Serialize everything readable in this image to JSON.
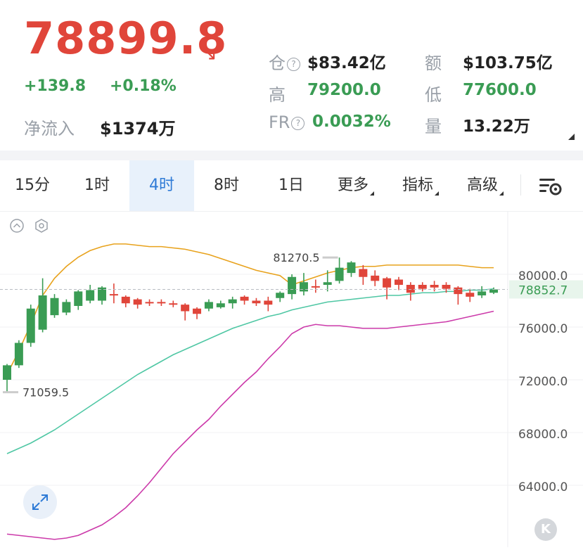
{
  "ticker": {
    "price": "78899.8",
    "change": "+139.8",
    "change_pct": "+0.18%",
    "net_inflow_label": "净流入",
    "net_inflow_value": "$1374万",
    "open_interest_label": "仓",
    "open_interest_value": "$83.42亿",
    "turnover_label": "额",
    "turnover_value": "$103.75亿",
    "high_label": "高",
    "high_value": "79200.0",
    "low_label": "低",
    "low_value": "77600.0",
    "fr_label": "FR",
    "fr_value": "0.0032%",
    "volume_label": "量",
    "volume_value": "13.22万",
    "help_glyph": "?",
    "down_color": "#e0453a",
    "up_color": "#3a9c54"
  },
  "tabs": [
    {
      "label": "15分",
      "active": false
    },
    {
      "label": "1时",
      "active": false
    },
    {
      "label": "4时",
      "active": true
    },
    {
      "label": "8时",
      "active": false
    },
    {
      "label": "1日",
      "active": false
    },
    {
      "label": "更多",
      "active": false
    },
    {
      "label": "指标",
      "active": false
    },
    {
      "label": "高级",
      "active": false
    }
  ],
  "k_button": "K",
  "chart_data": {
    "type": "candlestick",
    "y_ticks": [
      "80000.0",
      "76000.0",
      "72000.0",
      "68000.0",
      "64000.0"
    ],
    "y_tick_values": [
      80000,
      76000,
      72000,
      68000,
      64000
    ],
    "current_price_label": "78852.7",
    "current_price": 78852.7,
    "high_marker": "81270.5",
    "high_marker_value": 81270.5,
    "low_marker": "71059.5",
    "low_marker_value": 71059.5,
    "candles": [
      [
        72000,
        73100,
        71059.5,
        73200
      ],
      [
        73100,
        74800,
        72900,
        75000
      ],
      [
        74800,
        77400,
        74500,
        77700
      ],
      [
        75800,
        78400,
        75600,
        79700
      ],
      [
        76900,
        78200,
        76700,
        78500
      ],
      [
        77100,
        77900,
        76900,
        78100
      ],
      [
        77600,
        78700,
        77300,
        78800
      ],
      [
        78000,
        78800,
        77800,
        79200
      ],
      [
        78000,
        79000,
        77700,
        79100
      ],
      [
        78500,
        78400,
        77800,
        79300
      ],
      [
        78300,
        77800,
        77500,
        78400
      ],
      [
        78100,
        77700,
        77400,
        78200
      ],
      [
        77900,
        77800,
        77600,
        78100
      ],
      [
        77900,
        77800,
        77600,
        78100
      ],
      [
        77800,
        77700,
        77500,
        78000
      ],
      [
        77700,
        77200,
        76500,
        77800
      ],
      [
        77400,
        77000,
        76600,
        77500
      ],
      [
        77400,
        77900,
        77200,
        78100
      ],
      [
        77500,
        77800,
        77400,
        78000
      ],
      [
        77800,
        78100,
        77400,
        78300
      ],
      [
        78300,
        78000,
        77700,
        78400
      ],
      [
        78000,
        77800,
        77600,
        78200
      ],
      [
        78000,
        77700,
        77200,
        78300
      ],
      [
        78200,
        78600,
        77900,
        78700
      ],
      [
        78500,
        79800,
        78100,
        80000
      ],
      [
        78700,
        79400,
        78400,
        80100
      ],
      [
        79100,
        79000,
        78600,
        79600
      ],
      [
        79200,
        79400,
        78700,
        80300
      ],
      [
        79500,
        80500,
        79300,
        81270.5
      ],
      [
        80100,
        80900,
        79800,
        81000
      ],
      [
        80400,
        79800,
        79200,
        80700
      ],
      [
        79900,
        79500,
        79100,
        80300
      ],
      [
        79700,
        79000,
        78100,
        79800
      ],
      [
        79600,
        79200,
        78800,
        79800
      ],
      [
        79200,
        78600,
        78000,
        79400
      ],
      [
        79200,
        78900,
        78700,
        79400
      ],
      [
        79200,
        79000,
        78700,
        79500
      ],
      [
        79200,
        78900,
        78600,
        79400
      ],
      [
        79000,
        78500,
        77700,
        79100
      ],
      [
        78600,
        78300,
        77900,
        78900
      ],
      [
        78400,
        78700,
        78200,
        79100
      ],
      [
        78600,
        78852.7,
        78500,
        79000
      ]
    ],
    "series": [
      {
        "color": "#e8a21c",
        "values": [
          72400,
          74200,
          76200,
          78400,
          79700,
          80600,
          81300,
          81800,
          82100,
          82300,
          82300,
          82200,
          82100,
          82100,
          82000,
          81900,
          81700,
          81500,
          81200,
          80900,
          80600,
          80300,
          80100,
          79900,
          79200,
          79500,
          79800,
          80100,
          80300,
          80500,
          80600,
          80600,
          80700,
          80700,
          80700,
          80700,
          80700,
          80700,
          80700,
          80600,
          80500,
          80500
        ]
      },
      {
        "color": "#4fc7a4",
        "values": [
          66400,
          66800,
          67200,
          67700,
          68200,
          68800,
          69400,
          70000,
          70600,
          71200,
          71800,
          72400,
          72900,
          73400,
          73900,
          74300,
          74700,
          75100,
          75500,
          75900,
          76200,
          76500,
          76800,
          77000,
          77300,
          77500,
          77700,
          77900,
          78000,
          78100,
          78200,
          78300,
          78400,
          78400,
          78500,
          78600,
          78600,
          78700,
          78700,
          78800,
          78800,
          78900
        ]
      },
      {
        "color": "#cc3aaa",
        "values": [
          60300,
          60200,
          60100,
          60000,
          59900,
          60000,
          60200,
          60600,
          61000,
          61600,
          62300,
          63200,
          64200,
          65300,
          66400,
          67300,
          68200,
          69000,
          70000,
          70900,
          71800,
          72600,
          73600,
          74500,
          75500,
          76000,
          76200,
          76100,
          76100,
          76000,
          75900,
          75900,
          75900,
          76000,
          76100,
          76200,
          76300,
          76400,
          76600,
          76800,
          77000,
          77200
        ]
      }
    ]
  }
}
